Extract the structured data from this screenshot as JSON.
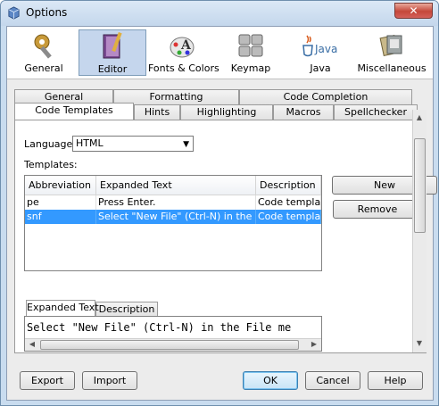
{
  "window": {
    "title": "Options",
    "close_glyph": "✕"
  },
  "categories": [
    {
      "label": "General",
      "icon": "gear-wrench-icon"
    },
    {
      "label": "Editor",
      "icon": "editor-notebook-icon"
    },
    {
      "label": "Fonts & Colors",
      "icon": "palette-font-icon"
    },
    {
      "label": "Keymap",
      "icon": "keyboard-icon"
    },
    {
      "label": "Java",
      "icon": "java-cup-icon",
      "logo_text": "Java"
    },
    {
      "label": "Miscellaneous",
      "icon": "misc-icon"
    }
  ],
  "tabs_row1": [
    "General",
    "Formatting",
    "Code Completion"
  ],
  "tabs_row2": [
    "Code Templates",
    "Hints",
    "Highlighting",
    "Macros",
    "Spellchecker"
  ],
  "language": {
    "label": "Language:",
    "value": "HTML"
  },
  "templates": {
    "label": "Templates:",
    "columns": [
      "Abbreviation",
      "Expanded Text",
      "Description"
    ],
    "rows": [
      {
        "abbr": "pe",
        "text": "Press Enter.",
        "desc": "Code template"
      },
      {
        "abbr": "snf",
        "text": "Select \"New File\" (Ctrl-N) in the Fil...",
        "desc": "Code template",
        "selected": true
      }
    ]
  },
  "side_buttons": {
    "new": "New",
    "remove": "Remove"
  },
  "lower_tabs": [
    "Expanded Text",
    "Description"
  ],
  "editor": {
    "value": "Select \"New File\" (Ctrl-N) in the File me"
  },
  "footer": {
    "export": "Export",
    "import": "Import",
    "ok": "OK",
    "cancel": "Cancel",
    "help": "Help"
  },
  "colors": {
    "selection": "#3399ff",
    "window_frame": "#c9dcef",
    "selected_category": "#c5d6ed"
  }
}
